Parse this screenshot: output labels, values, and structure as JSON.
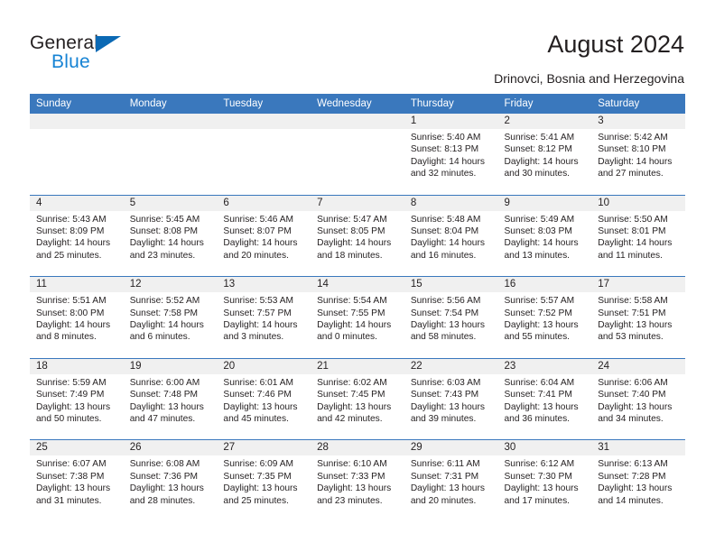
{
  "brand": {
    "name_top": "General",
    "name_bottom": "Blue",
    "triangle_color": "#0b69b4",
    "blue_text_color": "#1683d4"
  },
  "header": {
    "title": "August 2024",
    "subtitle": "Drinovci, Bosnia and Herzegovina",
    "header_bg": "#3a78bd",
    "header_text_color": "#ffffff",
    "daynum_band_bg": "#f0f0f0"
  },
  "weekday_headers": [
    "Sunday",
    "Monday",
    "Tuesday",
    "Wednesday",
    "Thursday",
    "Friday",
    "Saturday"
  ],
  "weeks": [
    [
      {
        "day": "",
        "sunrise": "",
        "sunset": "",
        "daylight_1": "",
        "daylight_2": ""
      },
      {
        "day": "",
        "sunrise": "",
        "sunset": "",
        "daylight_1": "",
        "daylight_2": ""
      },
      {
        "day": "",
        "sunrise": "",
        "sunset": "",
        "daylight_1": "",
        "daylight_2": ""
      },
      {
        "day": "",
        "sunrise": "",
        "sunset": "",
        "daylight_1": "",
        "daylight_2": ""
      },
      {
        "day": "1",
        "sunrise": "Sunrise: 5:40 AM",
        "sunset": "Sunset: 8:13 PM",
        "daylight_1": "Daylight: 14 hours",
        "daylight_2": "and 32 minutes."
      },
      {
        "day": "2",
        "sunrise": "Sunrise: 5:41 AM",
        "sunset": "Sunset: 8:12 PM",
        "daylight_1": "Daylight: 14 hours",
        "daylight_2": "and 30 minutes."
      },
      {
        "day": "3",
        "sunrise": "Sunrise: 5:42 AM",
        "sunset": "Sunset: 8:10 PM",
        "daylight_1": "Daylight: 14 hours",
        "daylight_2": "and 27 minutes."
      }
    ],
    [
      {
        "day": "4",
        "sunrise": "Sunrise: 5:43 AM",
        "sunset": "Sunset: 8:09 PM",
        "daylight_1": "Daylight: 14 hours",
        "daylight_2": "and 25 minutes."
      },
      {
        "day": "5",
        "sunrise": "Sunrise: 5:45 AM",
        "sunset": "Sunset: 8:08 PM",
        "daylight_1": "Daylight: 14 hours",
        "daylight_2": "and 23 minutes."
      },
      {
        "day": "6",
        "sunrise": "Sunrise: 5:46 AM",
        "sunset": "Sunset: 8:07 PM",
        "daylight_1": "Daylight: 14 hours",
        "daylight_2": "and 20 minutes."
      },
      {
        "day": "7",
        "sunrise": "Sunrise: 5:47 AM",
        "sunset": "Sunset: 8:05 PM",
        "daylight_1": "Daylight: 14 hours",
        "daylight_2": "and 18 minutes."
      },
      {
        "day": "8",
        "sunrise": "Sunrise: 5:48 AM",
        "sunset": "Sunset: 8:04 PM",
        "daylight_1": "Daylight: 14 hours",
        "daylight_2": "and 16 minutes."
      },
      {
        "day": "9",
        "sunrise": "Sunrise: 5:49 AM",
        "sunset": "Sunset: 8:03 PM",
        "daylight_1": "Daylight: 14 hours",
        "daylight_2": "and 13 minutes."
      },
      {
        "day": "10",
        "sunrise": "Sunrise: 5:50 AM",
        "sunset": "Sunset: 8:01 PM",
        "daylight_1": "Daylight: 14 hours",
        "daylight_2": "and 11 minutes."
      }
    ],
    [
      {
        "day": "11",
        "sunrise": "Sunrise: 5:51 AM",
        "sunset": "Sunset: 8:00 PM",
        "daylight_1": "Daylight: 14 hours",
        "daylight_2": "and 8 minutes."
      },
      {
        "day": "12",
        "sunrise": "Sunrise: 5:52 AM",
        "sunset": "Sunset: 7:58 PM",
        "daylight_1": "Daylight: 14 hours",
        "daylight_2": "and 6 minutes."
      },
      {
        "day": "13",
        "sunrise": "Sunrise: 5:53 AM",
        "sunset": "Sunset: 7:57 PM",
        "daylight_1": "Daylight: 14 hours",
        "daylight_2": "and 3 minutes."
      },
      {
        "day": "14",
        "sunrise": "Sunrise: 5:54 AM",
        "sunset": "Sunset: 7:55 PM",
        "daylight_1": "Daylight: 14 hours",
        "daylight_2": "and 0 minutes."
      },
      {
        "day": "15",
        "sunrise": "Sunrise: 5:56 AM",
        "sunset": "Sunset: 7:54 PM",
        "daylight_1": "Daylight: 13 hours",
        "daylight_2": "and 58 minutes."
      },
      {
        "day": "16",
        "sunrise": "Sunrise: 5:57 AM",
        "sunset": "Sunset: 7:52 PM",
        "daylight_1": "Daylight: 13 hours",
        "daylight_2": "and 55 minutes."
      },
      {
        "day": "17",
        "sunrise": "Sunrise: 5:58 AM",
        "sunset": "Sunset: 7:51 PM",
        "daylight_1": "Daylight: 13 hours",
        "daylight_2": "and 53 minutes."
      }
    ],
    [
      {
        "day": "18",
        "sunrise": "Sunrise: 5:59 AM",
        "sunset": "Sunset: 7:49 PM",
        "daylight_1": "Daylight: 13 hours",
        "daylight_2": "and 50 minutes."
      },
      {
        "day": "19",
        "sunrise": "Sunrise: 6:00 AM",
        "sunset": "Sunset: 7:48 PM",
        "daylight_1": "Daylight: 13 hours",
        "daylight_2": "and 47 minutes."
      },
      {
        "day": "20",
        "sunrise": "Sunrise: 6:01 AM",
        "sunset": "Sunset: 7:46 PM",
        "daylight_1": "Daylight: 13 hours",
        "daylight_2": "and 45 minutes."
      },
      {
        "day": "21",
        "sunrise": "Sunrise: 6:02 AM",
        "sunset": "Sunset: 7:45 PM",
        "daylight_1": "Daylight: 13 hours",
        "daylight_2": "and 42 minutes."
      },
      {
        "day": "22",
        "sunrise": "Sunrise: 6:03 AM",
        "sunset": "Sunset: 7:43 PM",
        "daylight_1": "Daylight: 13 hours",
        "daylight_2": "and 39 minutes."
      },
      {
        "day": "23",
        "sunrise": "Sunrise: 6:04 AM",
        "sunset": "Sunset: 7:41 PM",
        "daylight_1": "Daylight: 13 hours",
        "daylight_2": "and 36 minutes."
      },
      {
        "day": "24",
        "sunrise": "Sunrise: 6:06 AM",
        "sunset": "Sunset: 7:40 PM",
        "daylight_1": "Daylight: 13 hours",
        "daylight_2": "and 34 minutes."
      }
    ],
    [
      {
        "day": "25",
        "sunrise": "Sunrise: 6:07 AM",
        "sunset": "Sunset: 7:38 PM",
        "daylight_1": "Daylight: 13 hours",
        "daylight_2": "and 31 minutes."
      },
      {
        "day": "26",
        "sunrise": "Sunrise: 6:08 AM",
        "sunset": "Sunset: 7:36 PM",
        "daylight_1": "Daylight: 13 hours",
        "daylight_2": "and 28 minutes."
      },
      {
        "day": "27",
        "sunrise": "Sunrise: 6:09 AM",
        "sunset": "Sunset: 7:35 PM",
        "daylight_1": "Daylight: 13 hours",
        "daylight_2": "and 25 minutes."
      },
      {
        "day": "28",
        "sunrise": "Sunrise: 6:10 AM",
        "sunset": "Sunset: 7:33 PM",
        "daylight_1": "Daylight: 13 hours",
        "daylight_2": "and 23 minutes."
      },
      {
        "day": "29",
        "sunrise": "Sunrise: 6:11 AM",
        "sunset": "Sunset: 7:31 PM",
        "daylight_1": "Daylight: 13 hours",
        "daylight_2": "and 20 minutes."
      },
      {
        "day": "30",
        "sunrise": "Sunrise: 6:12 AM",
        "sunset": "Sunset: 7:30 PM",
        "daylight_1": "Daylight: 13 hours",
        "daylight_2": "and 17 minutes."
      },
      {
        "day": "31",
        "sunrise": "Sunrise: 6:13 AM",
        "sunset": "Sunset: 7:28 PM",
        "daylight_1": "Daylight: 13 hours",
        "daylight_2": "and 14 minutes."
      }
    ]
  ]
}
